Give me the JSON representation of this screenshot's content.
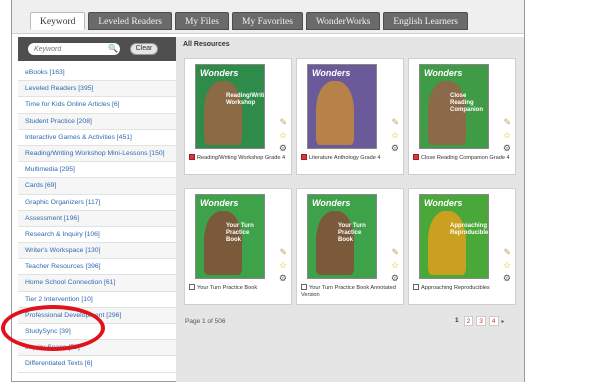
{
  "tabs": [
    {
      "label": "Keyword",
      "active": true
    },
    {
      "label": "Leveled Readers",
      "active": false
    },
    {
      "label": "My Files",
      "active": false
    },
    {
      "label": "My Favorites",
      "active": false
    },
    {
      "label": "WonderWorks",
      "active": false
    },
    {
      "label": "English Learners",
      "active": false
    }
  ],
  "search": {
    "placeholder": "Keyword",
    "clear_label": "Clear",
    "icon": "search-icon"
  },
  "categories": [
    "eBooks [163]",
    "Leveled Readers [395]",
    "Time for Kids Online Articles [6]",
    "Student Practice [208]",
    "Interactive Games & Activities [451]",
    "Reading/Writing Workshop Mini-Lessons [150]",
    "Multimedia [295]",
    "Cards [69]",
    "Graphic Organizers [117]",
    "Assessment [196]",
    "Research & Inquiry [106]",
    "Writer's Workspace [130]",
    "Teacher Resources [396]",
    "Home School Connection [61]",
    "Tier 2 Intervention [10]",
    "Professional Development [296]",
    "StudySync [39]",
    "Inquiry Space [59]",
    "Differentiated Texts [6]"
  ],
  "content": {
    "title": "All Resources",
    "cards": [
      {
        "caption": "Reading/Writing Workshop Grade 4",
        "logo": "Wonders",
        "cover_subtitle": "Reading/Writing Workshop",
        "cover_color": "#2e8b4a",
        "art_color": "#8b6a45",
        "type_icon": "book-icon"
      },
      {
        "caption": "Literature Anthology Grade 4",
        "logo": "Wonders",
        "cover_subtitle": "",
        "cover_color": "#6a5a9a",
        "art_color": "#b7824a",
        "type_icon": "book-icon"
      },
      {
        "caption": "Close Reading Companion Grade 4",
        "logo": "Wonders",
        "cover_subtitle": "Close Reading Companion",
        "cover_color": "#3f9b45",
        "art_color": "#8a6a48",
        "type_icon": "book-icon"
      },
      {
        "caption": "Your Turn Practice Book",
        "logo": "Wonders",
        "cover_subtitle": "Your Turn Practice Book",
        "cover_color": "#3ea24a",
        "art_color": "#7a5a3a",
        "type_icon": "document-icon"
      },
      {
        "caption": "Your Turn Practice Book Annotated Version",
        "logo": "Wonders",
        "cover_subtitle": "Your Turn Practice Book",
        "cover_color": "#3ea24a",
        "art_color": "#7a5a3a",
        "type_icon": "document-icon"
      },
      {
        "caption": "Approaching Reproducibles",
        "logo": "Wonders",
        "cover_subtitle": "Approaching Reproducibles",
        "cover_color": "#4aa73a",
        "art_color": "#c9a020",
        "type_icon": "document-icon"
      }
    ],
    "card_tools": {
      "pencil": "pencil-icon",
      "star": "star-icon",
      "gear": "gear-icon"
    },
    "page_text": "Page 1 of 506",
    "pages": [
      "1",
      "2",
      "3",
      "4"
    ],
    "current_page": "1",
    "next": "▸"
  },
  "annotation": {
    "color": "#e0121c"
  }
}
